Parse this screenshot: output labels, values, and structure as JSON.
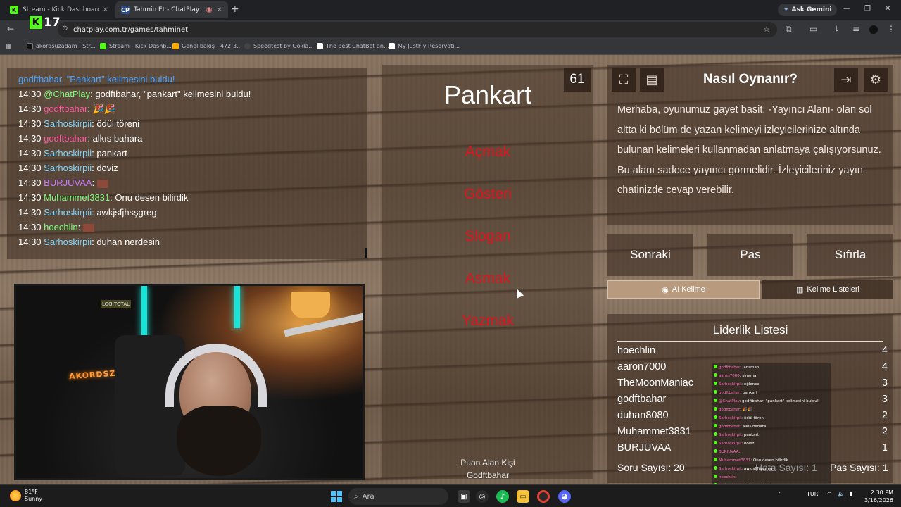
{
  "browser": {
    "tabs": [
      {
        "title": "Stream - Kick Dashboard",
        "active": false
      },
      {
        "title": "Tahmin Et - ChatPlay",
        "active": true
      }
    ],
    "gemini_label": "Ask Gemini",
    "url": "chatplay.com.tr/games/tahminet",
    "kick_count": "17",
    "bookmarks": [
      "akordsuzadam | Str...",
      "Stream - Kick Dashb...",
      "Genel bakış - 472-3...",
      "Speedtest by Ookla...",
      "The best ChatBot an...",
      "My JustFly Reservati..."
    ]
  },
  "chat": {
    "top_line": "godftbahar, \"Pankart\" kelimesini buldu!",
    "messages": [
      {
        "time": "14:30",
        "user": "@ChatPlay",
        "text": ": godftbahar, \"pankart\" kelimesini buldu!",
        "color": "#7CFC7C",
        "emote": false
      },
      {
        "time": "14:30",
        "user": "godftbahar",
        "text": ": 🎉🎉",
        "color": "#ff5aa0",
        "emote": false
      },
      {
        "time": "14:30",
        "user": "Sarhoskirpii",
        "text": ": ödül töreni",
        "color": "#7fd6ff",
        "emote": false
      },
      {
        "time": "14:30",
        "user": "godftbahar",
        "text": ": alkıs bahara",
        "color": "#ff5aa0",
        "emote": false
      },
      {
        "time": "14:30",
        "user": "Sarhoskirpii",
        "text": ": pankart",
        "color": "#7fd6ff",
        "emote": false
      },
      {
        "time": "14:30",
        "user": "Sarhoskirpii",
        "text": ": döviz",
        "color": "#7fd6ff",
        "emote": false
      },
      {
        "time": "14:30",
        "user": "BURJUVAA",
        "text": ": ",
        "color": "#c77dff",
        "emote": true
      },
      {
        "time": "14:30",
        "user": "Muhammet3831",
        "text": ": Onu desen bilirdik",
        "color": "#7CFC7C",
        "emote": false
      },
      {
        "time": "14:30",
        "user": "Sarhoskirpii",
        "text": ": awkjsfjhsşgreg",
        "color": "#7fd6ff",
        "emote": false
      },
      {
        "time": "14:30",
        "user": "hoechlin",
        "text": ": ",
        "color": "#7CFC7C",
        "emote": true
      },
      {
        "time": "14:30",
        "user": "Sarhoskirpii",
        "text": ": duhan nerdesin",
        "color": "#7fd6ff",
        "emote": false
      }
    ]
  },
  "webcam": {
    "sign_text": "AKORDSZ",
    "sign_small": "LOG.TOTAL"
  },
  "word_card": {
    "timer": "61",
    "main_word": "Pankart",
    "forbidden_words": [
      "Açmak",
      "Gösteri",
      "Slogan",
      "Asmak",
      "Yazmak"
    ],
    "scorer_label": "Puan Alan Kişi",
    "scorer_name": "Godftbahar"
  },
  "howto": {
    "title": "Nasıl Oynanır?",
    "text": "Merhaba, oyunumuz gayet basit. -Yayıncı Alanı- olan sol altta ki bölüm de yazan kelimeyi izleyicilerinize altında bulunan kelimeleri kullanmadan anlatmaya çalışıyorsunuz. Bu alanı sadece yayıncı görmelidir. İzleyicileriniz yayın chatinizde cevap verebilir."
  },
  "actions": {
    "next": "Sonraki",
    "pass": "Pas",
    "reset": "Sıfırla",
    "ai_tab": "AI Kelime",
    "lists_tab": "Kelime Listeleri"
  },
  "leaderboard": {
    "title": "Liderlik Listesi",
    "rows": [
      {
        "name": "hoechlin",
        "score": "4"
      },
      {
        "name": "aaron7000",
        "score": "4"
      },
      {
        "name": "TheMoonManiac",
        "score": "3"
      },
      {
        "name": "godftbahar",
        "score": "3"
      },
      {
        "name": "duhan8080",
        "score": "2"
      },
      {
        "name": "Muhammet3831",
        "score": "2"
      },
      {
        "name": "BURJUVAA",
        "score": "1"
      }
    ],
    "question_count": "Soru Sayısı: 20",
    "wrong_count": "Hata Sayısı: 1",
    "pass_count": "Pas Sayısı: 1"
  },
  "overlay_chat": [
    {
      "user": "godftbahar",
      "text": ": lansman"
    },
    {
      "user": "aaron7000",
      "text": ": sinema"
    },
    {
      "user": "Sarhoskirpii",
      "text": ": eğlence"
    },
    {
      "user": "godftbahar",
      "text": ": pankart"
    },
    {
      "user": "@ChatPlay",
      "text": ": godftbahar, \"pankart\" kelimesini buldu!"
    },
    {
      "user": "godftbahar",
      "text": ": 🎉🎉"
    },
    {
      "user": "Sarhoskirpii",
      "text": ": ödül töreni"
    },
    {
      "user": "godftbahar",
      "text": ": alkıs bahara"
    },
    {
      "user": "Sarhoskirpii",
      "text": ": pankart"
    },
    {
      "user": "Sarhoskirpii",
      "text": ": döviz"
    },
    {
      "user": "BURJUVAA",
      "text": ": "
    },
    {
      "user": "Muhammet3831",
      "text": ": Onu desen bilirdik"
    },
    {
      "user": "Sarhoskirpii",
      "text": ": awkjsfjhsşgreg"
    },
    {
      "user": "hoechlin",
      "text": ": "
    },
    {
      "user": "Sarhoskirpii",
      "text": ": duhan nerdesin"
    }
  ],
  "taskbar": {
    "temp": "81°F",
    "weather": "Sunny",
    "search_placeholder": "Ara",
    "lang": "TUR",
    "time": "2:30 PM",
    "date": "3/16/2026"
  }
}
